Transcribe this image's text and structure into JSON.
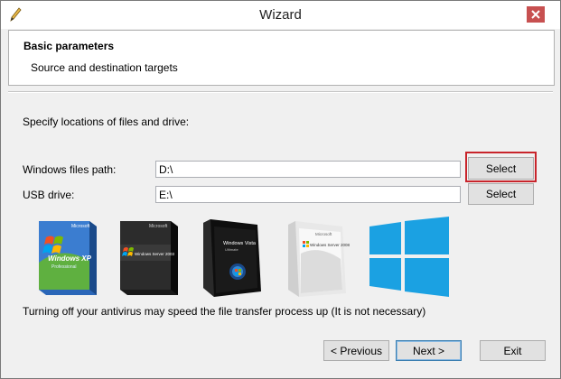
{
  "window": {
    "title": "Wizard"
  },
  "header": {
    "title": "Basic parameters",
    "subtitle": "Source and destination targets"
  },
  "body": {
    "instruction": "Specify locations of files and drive:",
    "windows_path_label": "Windows files path:",
    "windows_path_value": "D:\\",
    "usb_label": "USB drive:",
    "usb_value": "E:\\",
    "select_label": "Select",
    "note": "Turning off your antivirus may speed the file transfer process up (It is not necessary)"
  },
  "products": [
    {
      "icon": "windows-xp-box",
      "brand": "Microsoft",
      "name": "Windows XP",
      "edition": "Professional"
    },
    {
      "icon": "windows-server-2003-box",
      "brand": "Microsoft",
      "name": "Windows Server 2003"
    },
    {
      "icon": "windows-vista-box",
      "name": "Windows Vista",
      "edition": "Ultimate"
    },
    {
      "icon": "windows-server-2008-box",
      "brand": "Microsoft",
      "name": "Windows Server 2008"
    },
    {
      "icon": "windows-8-logo"
    }
  ],
  "footer": {
    "previous": "< Previous",
    "next": "Next >",
    "exit": "Exit"
  },
  "colors": {
    "highlight": "#c8242b",
    "win8_blue": "#1ba1e2",
    "xp_blue": "#1f5fb0"
  }
}
